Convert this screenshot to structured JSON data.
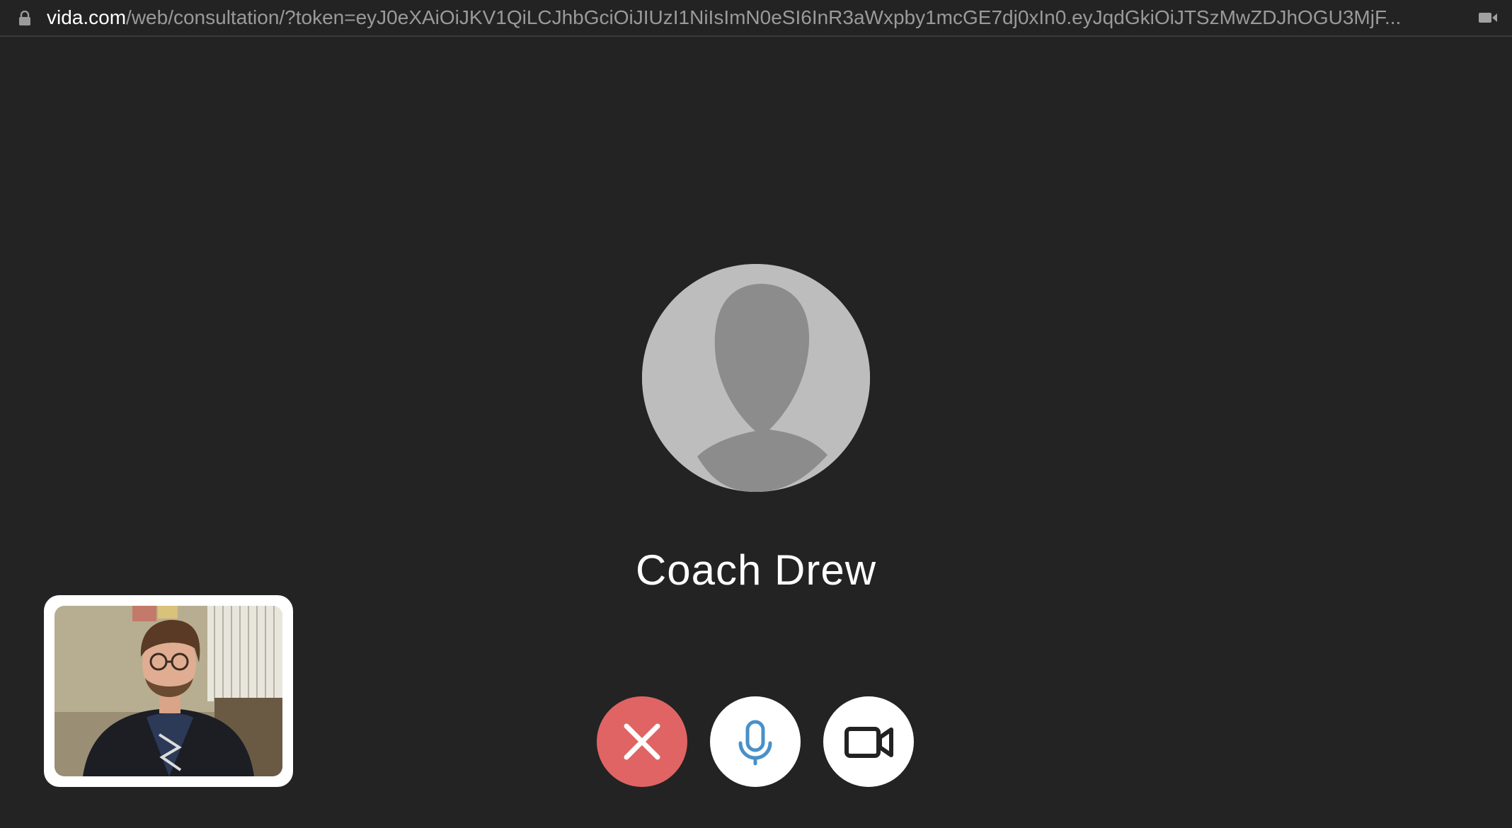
{
  "browser": {
    "url_host": "vida.com",
    "url_path": "/web/consultation/?token=eyJ0eXAiOiJKV1QiLCJhbGciOiJIUzI1NiIsImN0eSI6InR3aWxpby1mcGE7dj0xIn0.eyJqdGkiOiJTSzMwZDJhOGU3MjF...",
    "lock_icon": "lock-icon",
    "camera_indicator_icon": "video-camera-icon"
  },
  "call": {
    "contact_name": "Coach Drew",
    "avatar_icon": "default-person-avatar"
  },
  "controls": {
    "end_call_icon": "close-icon",
    "mic_icon": "microphone-icon",
    "camera_icon": "video-camera-icon"
  },
  "colors": {
    "background": "#232323",
    "end_call": "#e06464",
    "mic_accent": "#4a90c8"
  }
}
